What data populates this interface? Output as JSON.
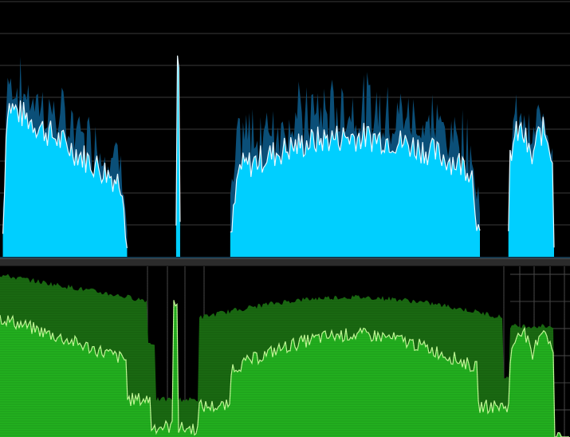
{
  "colors": {
    "spectrum_fill": "#00cfff",
    "spectrum_peak": "#0b4f78",
    "spectrum_line": "#e8f8ff",
    "spectrum_grid": "#3a3a3a",
    "spectrum_baseline": "#2a6f99",
    "history_fill": "#23b11f",
    "history_peak": "#1a6a12",
    "history_line": "#c6ff9a",
    "history_grid": "#4a4a4a"
  },
  "spectrum": {
    "horizontal_grid_lines": 8,
    "segments": [
      {
        "start": 0.005,
        "end": 0.223,
        "shape": "decay",
        "level": 0.62,
        "peak_extra": 0.18
      },
      {
        "start": 0.309,
        "end": 0.316,
        "shape": "spike",
        "level": 0.8,
        "peak_extra": 0.0
      },
      {
        "start": 0.404,
        "end": 0.842,
        "shape": "hump",
        "level": 0.48,
        "peak_extra": 0.22
      },
      {
        "start": 0.892,
        "end": 0.972,
        "shape": "double",
        "level": 0.5,
        "peak_extra": 0.12
      }
    ]
  },
  "history": {
    "vertical_grid_count": 10,
    "horizontal_grid_count": 6
  }
}
